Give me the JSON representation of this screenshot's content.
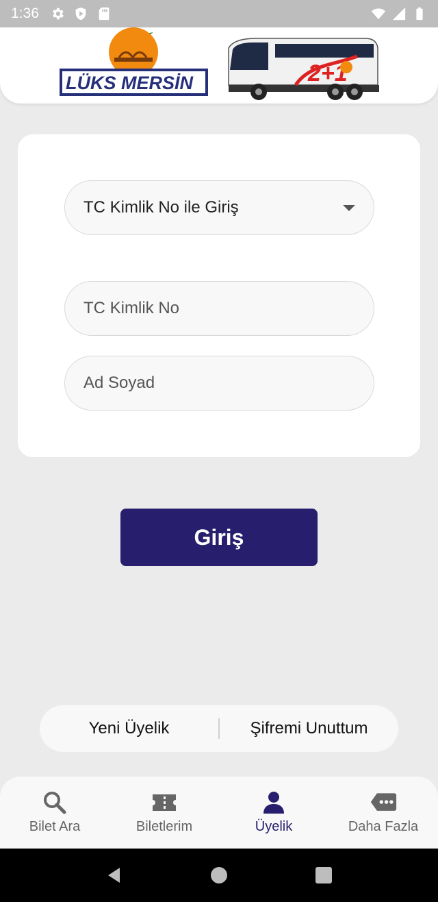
{
  "status_bar": {
    "time": "1:36",
    "left_icons": [
      "gear-icon",
      "shield-icon",
      "sd-card-icon"
    ],
    "right_icons": [
      "wifi-icon",
      "signal-icon",
      "battery-icon"
    ]
  },
  "header": {
    "logo_text": "LÜKS MERSİN",
    "bus_text": "2+1"
  },
  "form": {
    "login_type_selected": "TC Kimlik No ile Giriş",
    "tc_placeholder": "TC Kimlik No",
    "name_placeholder": "Ad Soyad"
  },
  "login_button_label": "Giriş",
  "links": {
    "new_membership": "Yeni Üyelik",
    "forgot_password": "Şifremi Unuttum"
  },
  "bottom_nav": {
    "items": [
      {
        "label": "Bilet Ara",
        "icon": "search-icon",
        "active": false
      },
      {
        "label": "Biletlerim",
        "icon": "ticket-icon",
        "active": false
      },
      {
        "label": "Üyelik",
        "icon": "person-icon",
        "active": true
      },
      {
        "label": "Daha Fazla",
        "icon": "more-chat-icon",
        "active": false
      }
    ]
  },
  "colors": {
    "accent": "#271f6e",
    "background": "#ebebeb",
    "status_bar": "#bdbdbd"
  }
}
